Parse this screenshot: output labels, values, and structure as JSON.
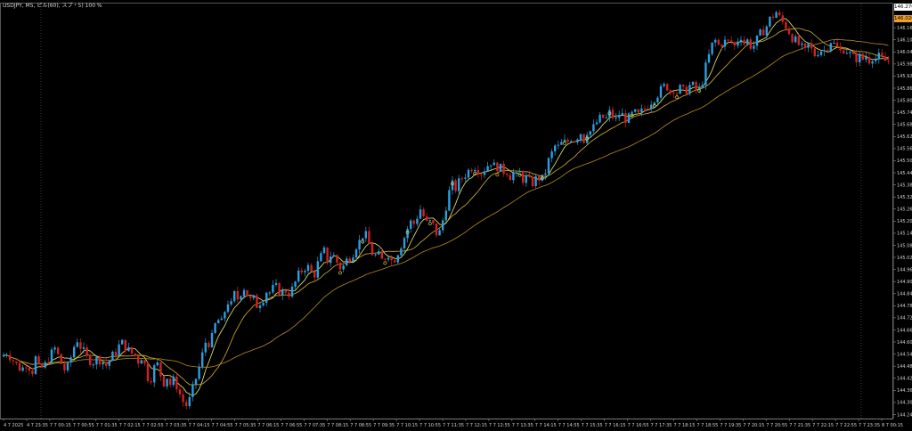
{
  "window": {
    "title": "USDJPY, M5, ピル(60), スプ・5) 100 %"
  },
  "colors": {
    "background": "#000000",
    "grid": "#444444",
    "bull": "#2b9fe0",
    "bear": "#d42020",
    "ma_fast": "#f0f070",
    "ma_mid": "#d8b030",
    "ma_slow": "#b88a20",
    "signal_buy": "#f0e040",
    "signal_sell": "#ff4040"
  },
  "price_boxes": {
    "bid": "146.270",
    "ask": "146.020"
  },
  "chart_data": {
    "type": "candlestick",
    "symbol": "USDJPY",
    "timeframe": "M5",
    "ylim": [
      144.22,
      146.28
    ],
    "y_ticks": [
      "146.160",
      "146.100",
      "146.040",
      "145.980",
      "145.920",
      "145.860",
      "145.800",
      "145.740",
      "145.680",
      "145.620",
      "145.560",
      "145.500",
      "145.440",
      "145.380",
      "145.320",
      "145.260",
      "145.200",
      "145.140",
      "145.080",
      "145.020",
      "144.960",
      "144.900",
      "144.840",
      "144.780",
      "144.720",
      "144.660",
      "144.600",
      "144.540",
      "144.480",
      "144.420",
      "144.360",
      "144.300",
      "144.240"
    ],
    "x_ticks": [
      "4 7 2025",
      "4 7 23:35",
      "7 7 00:15",
      "7 7 00:55",
      "7 7 01:35",
      "7 7 02:15",
      "7 7 02:55",
      "7 7 03:35",
      "7 7 04:15",
      "7 7 04:55",
      "7 7 05:35",
      "7 7 06:15",
      "7 7 06:55",
      "7 7 07:35",
      "7 7 08:15",
      "7 7 08:55",
      "7 7 09:35",
      "7 7 10:15",
      "7 7 10:55",
      "7 7 11:35",
      "7 7 12:15",
      "7 7 12:55",
      "7 7 13:35",
      "7 7 14:15",
      "7 7 14:55",
      "7 7 15:35",
      "7 7 16:15",
      "7 7 16:55",
      "7 7 17:35",
      "7 7 18:15",
      "7 7 18:55",
      "7 7 19:35",
      "7 7 20:15",
      "7 7 20:55",
      "7 7 21:35",
      "7 7 22:15",
      "7 7 22:55",
      "7 7 23:35",
      "8 7 00:15"
    ],
    "close_path": [
      [
        0,
        144.52
      ],
      [
        8,
        144.55
      ],
      [
        16,
        144.5
      ],
      [
        24,
        144.46
      ],
      [
        30,
        144.5
      ],
      [
        36,
        144.45
      ],
      [
        40,
        144.52
      ],
      [
        44,
        144.46
      ],
      [
        50,
        144.48
      ],
      [
        56,
        144.53
      ],
      [
        62,
        144.57
      ],
      [
        68,
        144.5
      ],
      [
        74,
        144.45
      ],
      [
        78,
        144.5
      ],
      [
        82,
        144.56
      ],
      [
        86,
        144.62
      ],
      [
        90,
        144.58
      ],
      [
        94,
        144.55
      ],
      [
        98,
        144.52
      ],
      [
        104,
        144.5
      ],
      [
        110,
        144.52
      ],
      [
        116,
        144.5
      ],
      [
        120,
        144.48
      ],
      [
        124,
        144.52
      ],
      [
        130,
        144.55
      ],
      [
        136,
        144.6
      ],
      [
        140,
        144.58
      ],
      [
        146,
        144.55
      ],
      [
        152,
        144.53
      ],
      [
        156,
        144.5
      ],
      [
        160,
        144.54
      ],
      [
        164,
        144.45
      ],
      [
        168,
        144.4
      ],
      [
        172,
        144.46
      ],
      [
        176,
        144.5
      ],
      [
        180,
        144.44
      ],
      [
        184,
        144.4
      ],
      [
        188,
        144.43
      ],
      [
        192,
        144.38
      ],
      [
        196,
        144.42
      ],
      [
        200,
        144.36
      ],
      [
        204,
        144.32
      ],
      [
        208,
        144.28
      ],
      [
        212,
        144.3
      ],
      [
        216,
        144.36
      ],
      [
        220,
        144.42
      ],
      [
        224,
        144.48
      ],
      [
        228,
        144.55
      ],
      [
        232,
        144.62
      ],
      [
        236,
        144.58
      ],
      [
        240,
        144.66
      ],
      [
        244,
        144.72
      ],
      [
        248,
        144.68
      ],
      [
        252,
        144.75
      ],
      [
        256,
        144.8
      ],
      [
        260,
        144.78
      ],
      [
        264,
        144.85
      ],
      [
        268,
        144.8
      ],
      [
        272,
        144.88
      ],
      [
        276,
        144.86
      ],
      [
        280,
        144.8
      ],
      [
        284,
        144.82
      ],
      [
        288,
        144.78
      ],
      [
        292,
        144.8
      ],
      [
        296,
        144.82
      ],
      [
        300,
        144.86
      ],
      [
        304,
        144.84
      ],
      [
        308,
        144.88
      ],
      [
        312,
        144.86
      ],
      [
        316,
        144.84
      ],
      [
        320,
        144.86
      ],
      [
        324,
        144.84
      ],
      [
        328,
        144.86
      ],
      [
        332,
        144.9
      ],
      [
        336,
        144.94
      ],
      [
        340,
        144.96
      ],
      [
        344,
        144.98
      ],
      [
        348,
        144.96
      ],
      [
        352,
        144.92
      ],
      [
        356,
        144.98
      ],
      [
        360,
        145.02
      ],
      [
        364,
        145.05
      ],
      [
        368,
        145.0
      ],
      [
        372,
        145.04
      ],
      [
        376,
        145.02
      ],
      [
        380,
        144.98
      ],
      [
        384,
        144.96
      ],
      [
        388,
        145.0
      ],
      [
        392,
        145.02
      ],
      [
        396,
        145.04
      ],
      [
        400,
        145.08
      ],
      [
        404,
        145.1
      ],
      [
        408,
        145.14
      ],
      [
        412,
        145.12
      ],
      [
        416,
        145.06
      ],
      [
        420,
        145.02
      ],
      [
        424,
        145.04
      ],
      [
        428,
        145.0
      ],
      [
        432,
        145.02
      ],
      [
        436,
        145.04
      ],
      [
        440,
        145.0
      ],
      [
        444,
        145.02
      ],
      [
        448,
        145.06
      ],
      [
        452,
        145.1
      ],
      [
        456,
        145.14
      ],
      [
        460,
        145.2
      ],
      [
        464,
        145.18
      ],
      [
        468,
        145.22
      ],
      [
        472,
        145.26
      ],
      [
        476,
        145.22
      ],
      [
        480,
        145.18
      ],
      [
        484,
        145.2
      ],
      [
        488,
        145.16
      ],
      [
        492,
        145.12
      ],
      [
        496,
        145.18
      ],
      [
        500,
        145.26
      ],
      [
        504,
        145.34
      ],
      [
        508,
        145.38
      ],
      [
        512,
        145.36
      ],
      [
        516,
        145.4
      ],
      [
        520,
        145.42
      ],
      [
        524,
        145.44
      ],
      [
        528,
        145.46
      ],
      [
        532,
        145.48
      ],
      [
        536,
        145.46
      ],
      [
        540,
        145.44
      ],
      [
        544,
        145.46
      ],
      [
        548,
        145.48
      ],
      [
        552,
        145.5
      ],
      [
        556,
        145.46
      ],
      [
        560,
        145.48
      ],
      [
        564,
        145.44
      ],
      [
        568,
        145.46
      ],
      [
        572,
        145.42
      ],
      [
        576,
        145.44
      ],
      [
        580,
        145.42
      ],
      [
        584,
        145.44
      ],
      [
        588,
        145.4
      ],
      [
        592,
        145.42
      ],
      [
        596,
        145.38
      ],
      [
        600,
        145.4
      ],
      [
        604,
        145.42
      ],
      [
        608,
        145.4
      ],
      [
        612,
        145.44
      ],
      [
        616,
        145.5
      ],
      [
        620,
        145.54
      ],
      [
        624,
        145.58
      ],
      [
        628,
        145.56
      ],
      [
        632,
        145.6
      ],
      [
        636,
        145.58
      ],
      [
        640,
        145.62
      ],
      [
        644,
        145.6
      ],
      [
        648,
        145.62
      ],
      [
        652,
        145.64
      ],
      [
        656,
        145.6
      ],
      [
        660,
        145.66
      ],
      [
        664,
        145.64
      ],
      [
        668,
        145.68
      ],
      [
        672,
        145.7
      ],
      [
        676,
        145.72
      ],
      [
        680,
        145.7
      ],
      [
        684,
        145.74
      ],
      [
        688,
        145.72
      ],
      [
        692,
        145.7
      ],
      [
        696,
        145.74
      ],
      [
        700,
        145.72
      ],
      [
        704,
        145.7
      ],
      [
        708,
        145.72
      ],
      [
        712,
        145.74
      ],
      [
        716,
        145.72
      ],
      [
        720,
        145.74
      ],
      [
        724,
        145.76
      ],
      [
        728,
        145.78
      ],
      [
        732,
        145.8
      ],
      [
        736,
        145.82
      ],
      [
        740,
        145.84
      ],
      [
        744,
        145.86
      ],
      [
        748,
        145.88
      ],
      [
        752,
        145.84
      ],
      [
        756,
        145.86
      ],
      [
        760,
        145.84
      ],
      [
        764,
        145.86
      ],
      [
        768,
        145.84
      ],
      [
        772,
        145.86
      ],
      [
        776,
        145.88
      ],
      [
        780,
        145.86
      ],
      [
        784,
        145.84
      ],
      [
        788,
        145.88
      ],
      [
        792,
        145.96
      ],
      [
        796,
        146.02
      ],
      [
        800,
        146.08
      ],
      [
        804,
        146.1
      ],
      [
        808,
        146.06
      ],
      [
        812,
        146.1
      ],
      [
        816,
        146.08
      ],
      [
        820,
        146.1
      ],
      [
        824,
        146.06
      ],
      [
        828,
        146.1
      ],
      [
        832,
        146.12
      ],
      [
        836,
        146.08
      ],
      [
        840,
        146.1
      ],
      [
        844,
        146.06
      ],
      [
        848,
        146.08
      ],
      [
        852,
        146.12
      ],
      [
        856,
        146.14
      ],
      [
        860,
        146.16
      ],
      [
        864,
        146.2
      ],
      [
        868,
        146.22
      ],
      [
        872,
        146.24
      ],
      [
        876,
        146.2
      ],
      [
        880,
        146.18
      ],
      [
        884,
        146.16
      ],
      [
        888,
        146.12
      ],
      [
        892,
        146.1
      ],
      [
        896,
        146.08
      ],
      [
        900,
        146.06
      ],
      [
        904,
        146.04
      ],
      [
        908,
        146.08
      ],
      [
        912,
        146.04
      ],
      [
        916,
        146.02
      ],
      [
        920,
        146.06
      ],
      [
        924,
        146.04
      ],
      [
        928,
        146.06
      ],
      [
        932,
        146.1
      ],
      [
        936,
        146.08
      ],
      [
        940,
        146.06
      ],
      [
        944,
        146.04
      ],
      [
        948,
        146.06
      ],
      [
        952,
        146.04
      ],
      [
        956,
        146.02
      ],
      [
        960,
        146.0
      ],
      [
        964,
        146.02
      ],
      [
        968,
        146.0
      ],
      [
        972,
        146.02
      ],
      [
        976,
        146.0
      ],
      [
        980,
        146.02
      ],
      [
        984,
        146.0
      ],
      [
        988,
        146.02
      ],
      [
        992,
        145.99
      ],
      [
        996,
        146.0
      ],
      [
        1000,
        145.99
      ]
    ]
  }
}
